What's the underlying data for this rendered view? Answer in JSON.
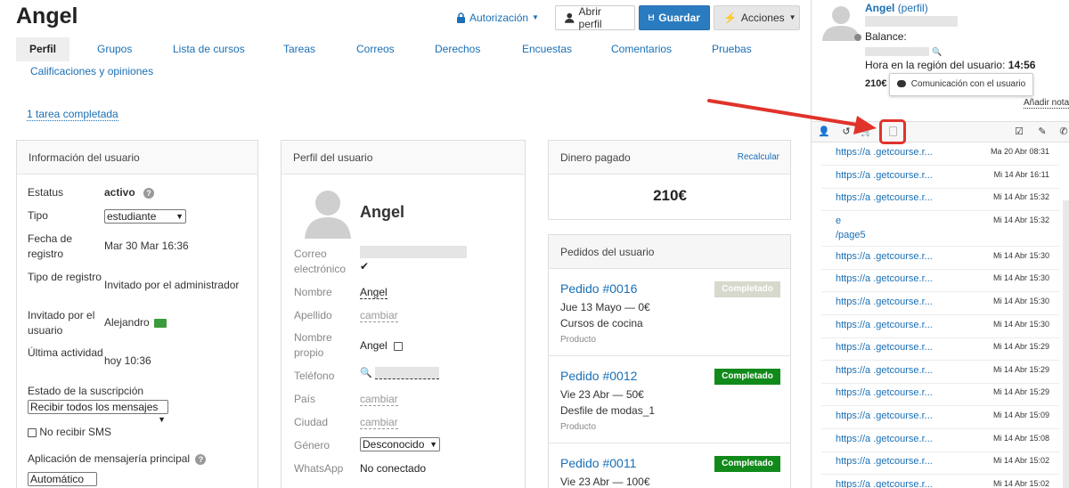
{
  "header": {
    "title": "Angel",
    "auth_label": "Autorización",
    "open_profile_label": "Abrir perfil",
    "save_label": "Guardar",
    "actions_label": "Acciones"
  },
  "tabs": [
    {
      "label": "Perfil",
      "active": true
    },
    {
      "label": "Grupos"
    },
    {
      "label": "Lista de cursos"
    },
    {
      "label": "Tareas"
    },
    {
      "label": "Correos"
    },
    {
      "label": "Derechos"
    },
    {
      "label": "Encuestas"
    },
    {
      "label": "Comentarios"
    },
    {
      "label": "Pruebas"
    },
    {
      "label": "Calificaciones y opiniones"
    }
  ],
  "tasks_link": "1 tarea completada",
  "user_info": {
    "title": "Información del usuario",
    "status_label": "Estatus",
    "status_value": "activo",
    "type_label": "Tipo",
    "type_value": "estudiante",
    "reg_date_label": "Fecha de registro",
    "reg_date_value": "Mar 30 Mar 16:36",
    "reg_type_label": "Tipo de registro",
    "reg_type_value": "Invitado por el administrador",
    "invited_label": "Invitado por el usuario",
    "invited_value": "Alejandro",
    "last_activity_label": "Última actividad",
    "last_activity_value": "hoy 10:36",
    "subscription_label": "Estado de la suscripción",
    "subscription_value": "Recibir todos los mensajes",
    "no_sms_label": "No recibir SMS",
    "messenger_label": "Aplicación de mensajería principal",
    "messenger_value": "Automático"
  },
  "profile": {
    "title": "Perfil del usuario",
    "name": "Angel",
    "email_label": "Correo electrónico",
    "nombre_label": "Nombre",
    "nombre_value": "Angel",
    "apellido_label": "Apellido",
    "change": "cambiar",
    "nombre_propio_label": "Nombre propio",
    "nombre_propio_value": "Angel",
    "telefono_label": "Teléfono",
    "pais_label": "País",
    "ciudad_label": "Ciudad",
    "genero_label": "Género",
    "genero_value": "Desconocido",
    "whatsapp_label": "WhatsApp",
    "whatsapp_value": "No conectado"
  },
  "paid": {
    "title": "Dinero pagado",
    "recalc": "Recalcular",
    "amount": "210€"
  },
  "orders": {
    "title": "Pedidos del usuario",
    "items": [
      {
        "number": "Pedido #0016",
        "date": "Jue 13 Mayo — 0€",
        "name": "Cursos de cocina",
        "type": "Producto",
        "status": "Completado",
        "status_color": "#d6d9cc"
      },
      {
        "number": "Pedido #0012",
        "date": "Vie 23 Abr — 50€",
        "name": "Desfile de modas_1",
        "type": "Producto",
        "status": "Completado",
        "status_color": "#118a1b"
      },
      {
        "number": "Pedido #0011",
        "date": "Vie 23 Abr — 100€",
        "name": "",
        "type": "",
        "status": "Completado",
        "status_color": "#118a1b"
      }
    ]
  },
  "sidebar": {
    "name": "Angel",
    "profile_link": "(perfil)",
    "balance_label": "Balance:",
    "region_time_label": "Hora en la región del usuario:",
    "region_time_value": "14:56",
    "amount": "210€",
    "comm_tooltip": "Comunicación con el usuario",
    "add_note": "Añadir nota",
    "visits": [
      {
        "url": "https://a        .getcourse.r...",
        "date": "Ma 20 Abr 08:31"
      },
      {
        "url": "https://a        .getcourse.r...",
        "date": "Mi 14 Abr 16:11"
      },
      {
        "url": "https://a        .getcourse.r...",
        "date": "Mi 14 Abr 15:32"
      },
      {
        "url": "e",
        "url2": "/page5",
        "date": "Mi 14 Abr 15:32"
      },
      {
        "url": "https://a        .getcourse.r...",
        "date": "Mi 14 Abr 15:30"
      },
      {
        "url": "https://a        .getcourse.r...",
        "date": "Mi 14 Abr 15:30"
      },
      {
        "url": "https://a        .getcourse.r...",
        "date": "Mi 14 Abr 15:30"
      },
      {
        "url": "https://a        .getcourse.r...",
        "date": "Mi 14 Abr 15:30"
      },
      {
        "url": "https://a        .getcourse.r...",
        "date": "Mi 14 Abr 15:29"
      },
      {
        "url": "https://a        .getcourse.r...",
        "date": "Mi 14 Abr 15:29"
      },
      {
        "url": "https://a        .getcourse.r...",
        "date": "Mi 14 Abr 15:29"
      },
      {
        "url": "https://a        .getcourse.r...",
        "date": "Mi 14 Abr 15:09"
      },
      {
        "url": "https://a        .getcourse.r...",
        "date": "Mi 14 Abr 15:08"
      },
      {
        "url": "https://a        .getcourse.r...",
        "date": "Mi 14 Abr 15:02"
      },
      {
        "url": "https://a        .getcourse.r...",
        "date": "Mi 14 Abr 15:02"
      }
    ]
  },
  "colors": {
    "link": "#1a6fb5",
    "primary": "#2a7bbf",
    "highlight": "#e0332b",
    "badge_green": "#118a1b"
  }
}
